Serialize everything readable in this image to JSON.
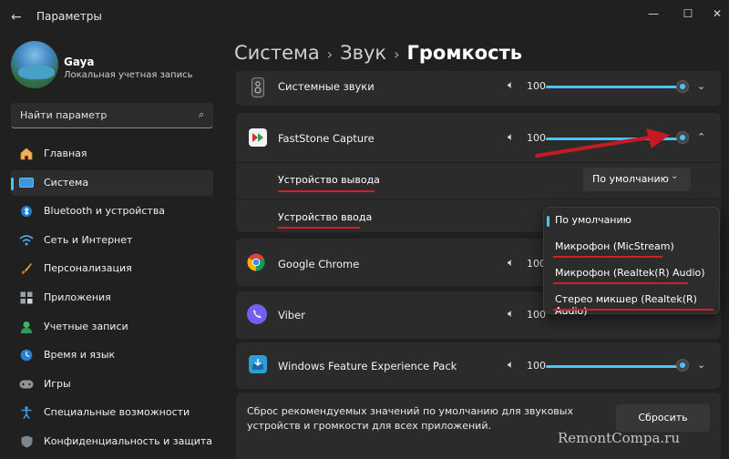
{
  "window": {
    "title": "Параметры",
    "back_icon": "arrow-left-icon",
    "minimize_glyph": "—",
    "maximize_glyph": "☐",
    "close_glyph": "✕"
  },
  "profile": {
    "name": "Gaya",
    "account_type": "Локальная учетная запись"
  },
  "search": {
    "placeholder": "Найти параметр"
  },
  "nav": {
    "items": [
      {
        "label": "Главная",
        "icon": "home-icon",
        "active": false
      },
      {
        "label": "Система",
        "icon": "system-icon",
        "active": true
      },
      {
        "label": "Bluetooth и устройства",
        "icon": "bluetooth-icon",
        "active": false
      },
      {
        "label": "Сеть и Интернет",
        "icon": "network-icon",
        "active": false
      },
      {
        "label": "Персонализация",
        "icon": "brush-icon",
        "active": false
      },
      {
        "label": "Приложения",
        "icon": "apps-icon",
        "active": false
      },
      {
        "label": "Учетные записи",
        "icon": "accounts-icon",
        "active": false
      },
      {
        "label": "Время и язык",
        "icon": "time-language-icon",
        "active": false
      },
      {
        "label": "Игры",
        "icon": "gaming-icon",
        "active": false
      },
      {
        "label": "Специальные возможности",
        "icon": "accessibility-icon",
        "active": false
      },
      {
        "label": "Конфиденциальность и защита",
        "icon": "shield-icon",
        "active": false
      }
    ]
  },
  "breadcrumb": {
    "part1": "Система",
    "part2": "Звук",
    "current": "Громкость",
    "separator": "›"
  },
  "apps": {
    "system_sounds": {
      "name": "Системные звуки",
      "volume": "100",
      "volume_fraction": 1.0
    },
    "faststone": {
      "name": "FastStone Capture",
      "volume": "100",
      "volume_fraction": 1.0,
      "expanded": true
    },
    "chrome": {
      "name": "Google Chrome",
      "volume": "100",
      "volume_fraction": 1.0
    },
    "viber": {
      "name": "Viber",
      "volume": "100",
      "volume_fraction": 1.0
    },
    "wfep": {
      "name": "Windows Feature Experience Pack",
      "volume": "100",
      "volume_fraction": 1.0
    }
  },
  "faststone_settings": {
    "output_label": "Устройство вывода",
    "output_value": "По умолчанию",
    "input_label": "Устройство ввода"
  },
  "input_dropdown": {
    "options": [
      {
        "label": "По умолчанию",
        "selected": true
      },
      {
        "label": "Микрофон (MicStream)",
        "selected": false
      },
      {
        "label": "Микрофон (Realtek(R) Audio)",
        "selected": false
      },
      {
        "label": "Стерео микшер (Realtek(R) Audio)",
        "selected": false
      }
    ]
  },
  "reset": {
    "text": "Сброс рекомендуемых значений по умолчанию для звуковых устройств и громкости для всех приложений.",
    "button_label": "Сбросить"
  },
  "watermark": "RemontCompa.ru",
  "colors": {
    "accent": "#4cc2ff",
    "annotation_red": "#d11e2a",
    "background": "#202020",
    "card": "#2b2b2b"
  }
}
